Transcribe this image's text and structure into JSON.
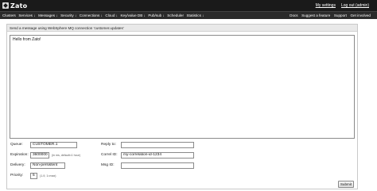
{
  "app": {
    "name": "Zato"
  },
  "header": {
    "links": [
      "My settings",
      "Log out (admin)"
    ]
  },
  "menu": {
    "left": [
      "Clusters",
      "Services ↓",
      "Messages ↓",
      "Security ↓",
      "Connections ↓",
      "Cloud ↓",
      "Key/value DB ↓",
      "Pub/sub ↓",
      "Scheduler",
      "Statistics ↓"
    ],
    "right": [
      "Docs",
      "Suggest a feature",
      "Support",
      "Get involved"
    ]
  },
  "form": {
    "title": "Send a message using WebSphere MQ connection 'customer.updates'",
    "message": "Hello from Zato!",
    "queue": {
      "label": "Queue:",
      "value": "CUSTOMER.1"
    },
    "expiration": {
      "label": "Expiration:",
      "value": "3600000",
      "hint": "(in ms, default=1 hour)"
    },
    "delivery": {
      "label": "Delivery:",
      "value": "Non-persistent"
    },
    "priority": {
      "label": "Priority:",
      "value": "5",
      "hint": "(1-9, 1=max)"
    },
    "reply_to": {
      "label": "Reply to:",
      "value": ""
    },
    "correl_id": {
      "label": "Correl ID:",
      "value": "my-correlation-id-1234"
    },
    "msg_id": {
      "label": "Msg ID:",
      "value": ""
    },
    "submit_label": "Submit"
  }
}
